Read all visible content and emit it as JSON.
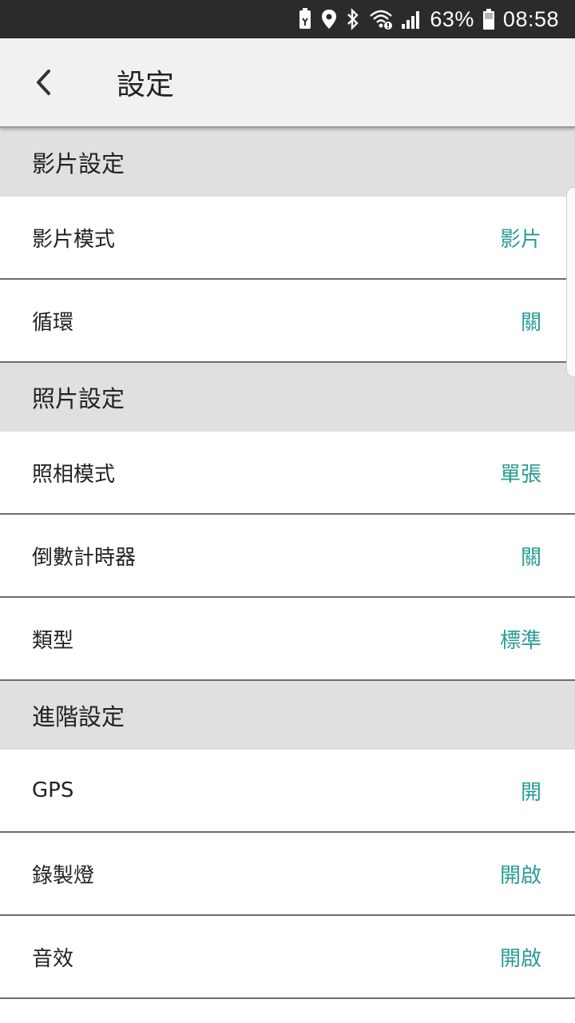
{
  "status_bar": {
    "battery_percent": "63%",
    "time": "08:58"
  },
  "header": {
    "title": "設定"
  },
  "sections": [
    {
      "title": "影片設定",
      "items": [
        {
          "label": "影片模式",
          "value": "影片"
        },
        {
          "label": "循環",
          "value": "關"
        }
      ]
    },
    {
      "title": "照片設定",
      "items": [
        {
          "label": "照相模式",
          "value": "單張"
        },
        {
          "label": "倒數計時器",
          "value": "關"
        },
        {
          "label": "類型",
          "value": "標準"
        }
      ]
    },
    {
      "title": "進階設定",
      "items": [
        {
          "label": "GPS",
          "value": "開"
        },
        {
          "label": "錄製燈",
          "value": "開啟"
        },
        {
          "label": "音效",
          "value": "開啟"
        }
      ]
    }
  ],
  "colors": {
    "accent": "#2a9d97",
    "section_bg": "#e0e0e0",
    "appbar_bg": "#f1f1f1",
    "statusbar_bg": "#2b2b2b"
  }
}
